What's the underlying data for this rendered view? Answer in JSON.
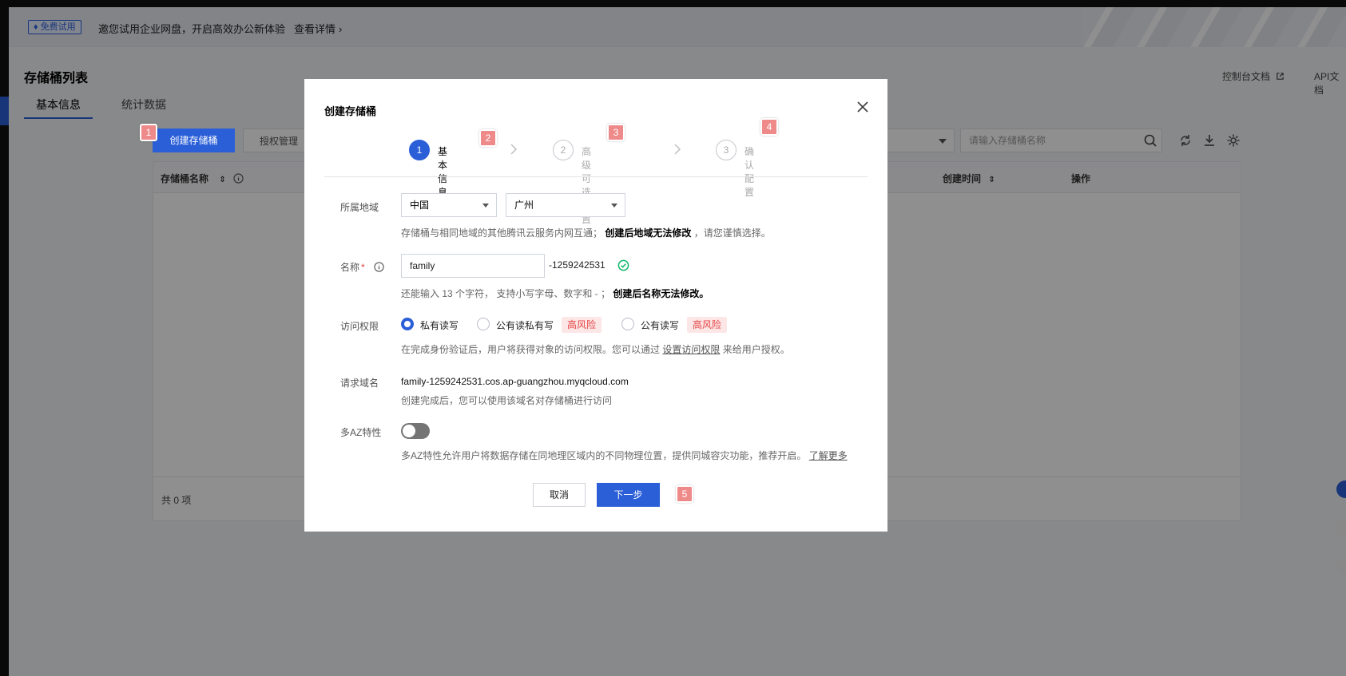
{
  "banner": {
    "badge": "免费试用",
    "text": "邀您试用企业网盘，开启高效办公新体验",
    "link": "查看详情"
  },
  "page": {
    "title": "存储桶列表",
    "links": [
      "控制台文档",
      "API文档"
    ],
    "tabs": [
      "基本信息",
      "统计数据"
    ]
  },
  "toolbar": {
    "create_button": "创建存储桶",
    "auth_button": "授权管理",
    "search_placeholder": "请输入存储桶名称"
  },
  "table": {
    "columns": [
      "存储桶名称",
      "创建时间",
      "操作"
    ],
    "footer": "共 0 项"
  },
  "modal": {
    "title": "创建存储桶",
    "steps": [
      {
        "num": "1",
        "label": "基本信息"
      },
      {
        "num": "2",
        "label": "高级可选配置"
      },
      {
        "num": "3",
        "label": "确认配置"
      }
    ],
    "region": {
      "label": "所属地域",
      "country": "中国",
      "city": "广州",
      "hint_plain": "存储桶与相同地域的其他腾讯云服务内网互通；",
      "hint_bold": "创建后地域无法修改",
      "hint_tail": "，请您谨慎选择。"
    },
    "name": {
      "label": "名称",
      "required_mark": "*",
      "value": "family",
      "suffix": "-1259242531",
      "hint_plain": "还能输入 13 个字符， 支持小写字母、数字和 - ；",
      "hint_bold": "创建后名称无法修改。"
    },
    "access": {
      "label": "访问权限",
      "options": [
        "私有读写",
        "公有读私有写",
        "公有读写"
      ],
      "risk_badge": "高风险",
      "hint_plain": "在完成身份验证后，用户将获得对象的访问权限。您可以通过",
      "hint_link": "设置访问权限",
      "hint_tail": "来给用户授权。"
    },
    "domain": {
      "label": "请求域名",
      "value": "family-1259242531.cos.ap-guangzhou.myqcloud.com",
      "hint": "创建完成后，您可以使用该域名对存储桶进行访问"
    },
    "multi_az": {
      "label": "多AZ特性",
      "enabled": false,
      "hint": "多AZ特性允许用户将数据存储在同地理区域内的不同物理位置，提供同城容灾功能，推荐开启。",
      "hint_link": "了解更多"
    },
    "buttons": {
      "cancel": "取消",
      "next": "下一步"
    }
  },
  "markers": [
    "1",
    "2",
    "3",
    "4",
    "5"
  ],
  "colors": {
    "primary": "#2b5fd8",
    "risk": "#e54545",
    "marker": "#ef8a8a"
  }
}
